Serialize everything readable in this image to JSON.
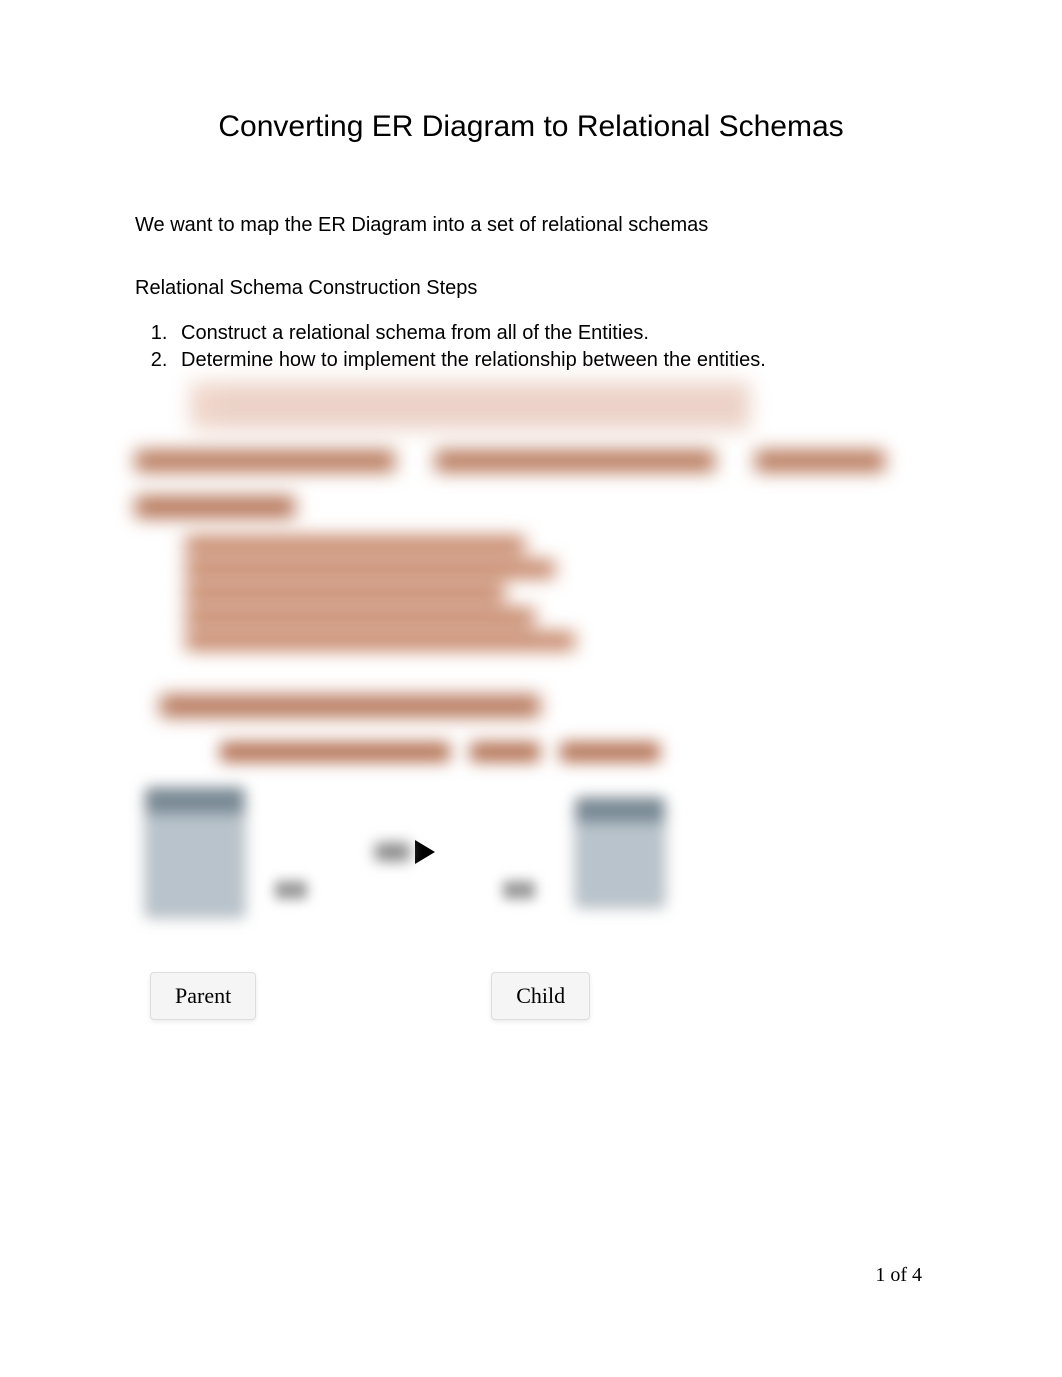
{
  "title": "Converting ER Diagram to Relational Schemas",
  "intro": "We want to map the ER Diagram into a set of relational schemas",
  "section_heading": "Relational Schema Construction Steps",
  "steps": [
    "Construct a relational schema from all of the Entities.",
    "Determine how to implement the relationship between the entities."
  ],
  "labels": {
    "parent": "Parent",
    "child": "Child"
  },
  "page_number": "1 of 4"
}
